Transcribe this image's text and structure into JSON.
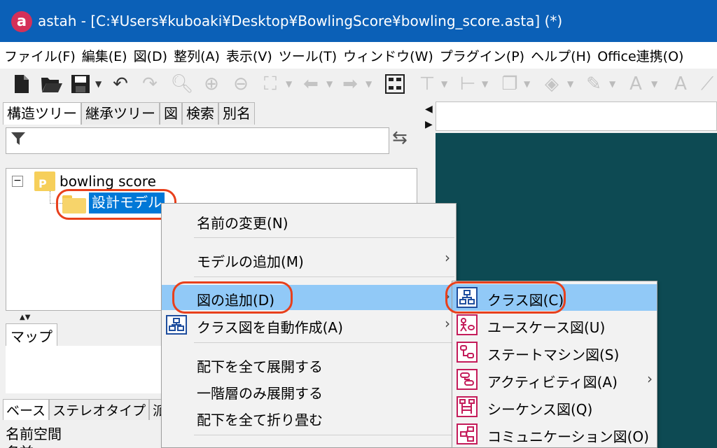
{
  "window": {
    "logo_letter": "a",
    "title": "astah - [C:¥Users¥kuboaki¥Desktop¥BowlingScore¥bowling_score.asta] (*)"
  },
  "menubar": {
    "items": [
      "ファイル(F)",
      "編集(E)",
      "図(D)",
      "整列(A)",
      "表示(V)",
      "ツール(T)",
      "ウィンドウ(W)",
      "プラグイン(P)",
      "ヘルプ(H)",
      "Office連携(O)"
    ]
  },
  "toolbar": {
    "icons": [
      "new-file-icon",
      "open-folder-icon",
      "save-icon",
      "undo-icon",
      "redo-icon",
      "zoom-icon",
      "zoom-in-icon",
      "zoom-out-icon",
      "fit-icon",
      "back-icon",
      "forward-icon",
      "model-icon",
      "align-top-icon",
      "align-left-icon",
      "arrange-icon",
      "fill-color-icon",
      "line-color-icon",
      "font-color-icon",
      "font-size-icon"
    ]
  },
  "left_panel": {
    "tabs": [
      "構造ツリー",
      "継承ツリー",
      "図",
      "検索",
      "別名"
    ],
    "filter": {
      "value": "",
      "placeholder": ""
    },
    "tree": {
      "expander": "−",
      "project_badge": "P",
      "project": "bowling score",
      "model": "設計モデル"
    },
    "map_tab": "マップ",
    "bottom_tabs": [
      "ベース",
      "ステレオタイプ",
      "派"
    ],
    "prop_namespace": "名前空間",
    "prop_name_partial": "名前"
  },
  "context_menu": {
    "items": [
      {
        "label": "名前の変更(N)",
        "submenu": false
      },
      {
        "label": "モデルの追加(M)",
        "submenu": true
      },
      {
        "label": "図の追加(D)",
        "submenu": true,
        "highlighted": true
      },
      {
        "label": "クラス図を自動作成(A)",
        "submenu": true
      },
      {
        "label": "配下を全て展開する",
        "submenu": false
      },
      {
        "label": "一階層のみ展開する",
        "submenu": false
      },
      {
        "label": "配下を全て折り畳む",
        "submenu": false
      }
    ],
    "submenu_arrow": "›"
  },
  "diagram_submenu": {
    "items": [
      {
        "label": "クラス図(C)",
        "icon": "class-diagram-icon",
        "highlighted": true
      },
      {
        "label": "ユースケース図(U)",
        "icon": "usecase-diagram-icon"
      },
      {
        "label": "ステートマシン図(S)",
        "icon": "statemachine-diagram-icon"
      },
      {
        "label": "アクティビティ図(A)",
        "icon": "activity-diagram-icon",
        "submenu": true
      },
      {
        "label": "シーケンス図(Q)",
        "icon": "sequence-diagram-icon"
      },
      {
        "label": "コミュニケーション図(O)",
        "icon": "communication-diagram-icon"
      }
    ]
  },
  "colors": {
    "titlebar": "#0b60b7",
    "selection": "#0078d7",
    "menu_highlight": "#91c9f7",
    "annotation_red": "#e8401c",
    "canvas": "#0d4a53"
  }
}
